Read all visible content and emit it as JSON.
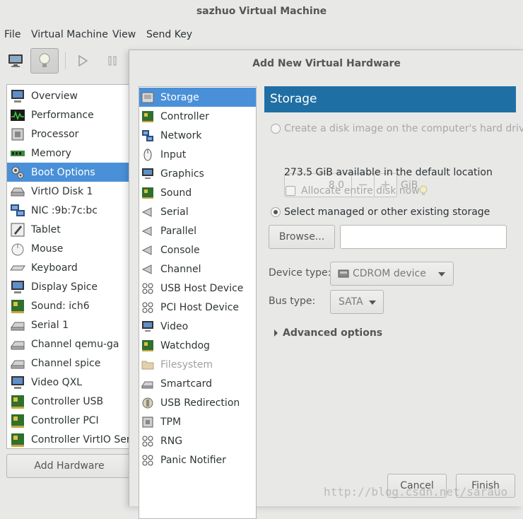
{
  "window": {
    "title": "sazhuo Virtual Machine"
  },
  "menu": [
    "File",
    "Virtual Machine",
    "View",
    "Send Key"
  ],
  "hardware_list": [
    {
      "label": "Overview",
      "icon": "monitor-icon"
    },
    {
      "label": "Performance",
      "icon": "performance-graph-icon"
    },
    {
      "label": "Processor",
      "icon": "processor-chip-icon"
    },
    {
      "label": "Memory",
      "icon": "memory-module-icon"
    },
    {
      "label": "Boot Options",
      "icon": "boot-gear-icon",
      "selected": true
    },
    {
      "label": "VirtIO Disk 1",
      "icon": "disk-drive-icon"
    },
    {
      "label": "NIC :9b:7c:bc",
      "icon": "network-card-icon"
    },
    {
      "label": "Tablet",
      "icon": "tablet-pen-icon"
    },
    {
      "label": "Mouse",
      "icon": "mouse-icon"
    },
    {
      "label": "Keyboard",
      "icon": "keyboard-icon"
    },
    {
      "label": "Display Spice",
      "icon": "display-icon"
    },
    {
      "label": "Sound: ich6",
      "icon": "sound-card-icon"
    },
    {
      "label": "Serial 1",
      "icon": "serial-port-icon"
    },
    {
      "label": "Channel qemu-ga",
      "icon": "channel-icon"
    },
    {
      "label": "Channel spice",
      "icon": "channel-icon"
    },
    {
      "label": "Video QXL",
      "icon": "video-icon"
    },
    {
      "label": "Controller USB",
      "icon": "controller-card-icon"
    },
    {
      "label": "Controller PCI",
      "icon": "controller-card-icon"
    },
    {
      "label": "Controller VirtIO Serial",
      "icon": "controller-card-icon"
    }
  ],
  "add_hardware_label": "Add Hardware",
  "dialog": {
    "title": "Add New Virtual Hardware",
    "device_types": [
      {
        "label": "Storage",
        "icon": "storage-icon",
        "selected": true
      },
      {
        "label": "Controller",
        "icon": "controller-icon"
      },
      {
        "label": "Network",
        "icon": "network-icon"
      },
      {
        "label": "Input",
        "icon": "mouse-input-icon"
      },
      {
        "label": "Graphics",
        "icon": "graphics-icon"
      },
      {
        "label": "Sound",
        "icon": "sound-icon"
      },
      {
        "label": "Serial",
        "icon": "serial-icon"
      },
      {
        "label": "Parallel",
        "icon": "parallel-icon"
      },
      {
        "label": "Console",
        "icon": "console-icon"
      },
      {
        "label": "Channel",
        "icon": "channel-icon"
      },
      {
        "label": "USB Host Device",
        "icon": "usb-device-icon"
      },
      {
        "label": "PCI Host Device",
        "icon": "pci-device-icon"
      },
      {
        "label": "Video",
        "icon": "video-icon"
      },
      {
        "label": "Watchdog",
        "icon": "watchdog-icon"
      },
      {
        "label": "Filesystem",
        "icon": "folder-icon",
        "disabled": true
      },
      {
        "label": "Smartcard",
        "icon": "smartcard-icon"
      },
      {
        "label": "USB Redirection",
        "icon": "usb-redirection-icon"
      },
      {
        "label": "TPM",
        "icon": "tpm-chip-icon"
      },
      {
        "label": "RNG",
        "icon": "rng-icon"
      },
      {
        "label": "Panic Notifier",
        "icon": "panic-notifier-icon"
      }
    ],
    "storage": {
      "header": "Storage",
      "create_disk_label": "Create a disk image on the computer's hard drive",
      "size_value": "8.0",
      "size_unit": "GiB",
      "available_text": "273.5 GiB available in the default location",
      "allocate_label": "Allocate entire disk now",
      "select_existing_label": "Select managed or other existing storage",
      "browse_label": "Browse...",
      "path_value": "",
      "device_type_label": "Device type:",
      "device_type_value": "CDROM device",
      "bus_type_label": "Bus type:",
      "bus_type_value": "SATA",
      "advanced_label": "Advanced options"
    },
    "cancel_label": "Cancel",
    "finish_label": "Finish"
  },
  "watermark": "http://blog.csdn.net/sarauo",
  "colors": {
    "selection": "#4a90d9",
    "panel_header": "#1f6fa4"
  }
}
